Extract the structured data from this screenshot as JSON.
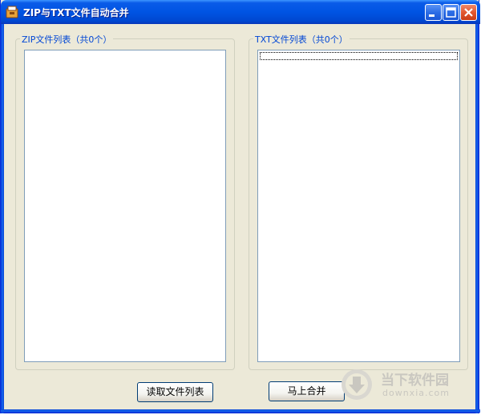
{
  "window": {
    "title": "ZIP与TXT文件自动合并",
    "icon": "folder-icon",
    "controls": [
      "minimize-icon",
      "maximize-icon",
      "close-icon"
    ]
  },
  "zip_group": {
    "legend": "ZIP文件列表（共0个）",
    "items": []
  },
  "txt_group": {
    "legend": "TXT文件列表（共0个）",
    "items": []
  },
  "buttons": {
    "read_list": "读取文件列表",
    "merge_now": "马上合并"
  },
  "watermark": {
    "name": "当下软件园",
    "site": "downxia.com"
  },
  "colors": {
    "titlebar": "#0054e3",
    "legend_text": "#0046d5",
    "window_bg": "#ece9d8",
    "close_button": "#e2572f"
  }
}
